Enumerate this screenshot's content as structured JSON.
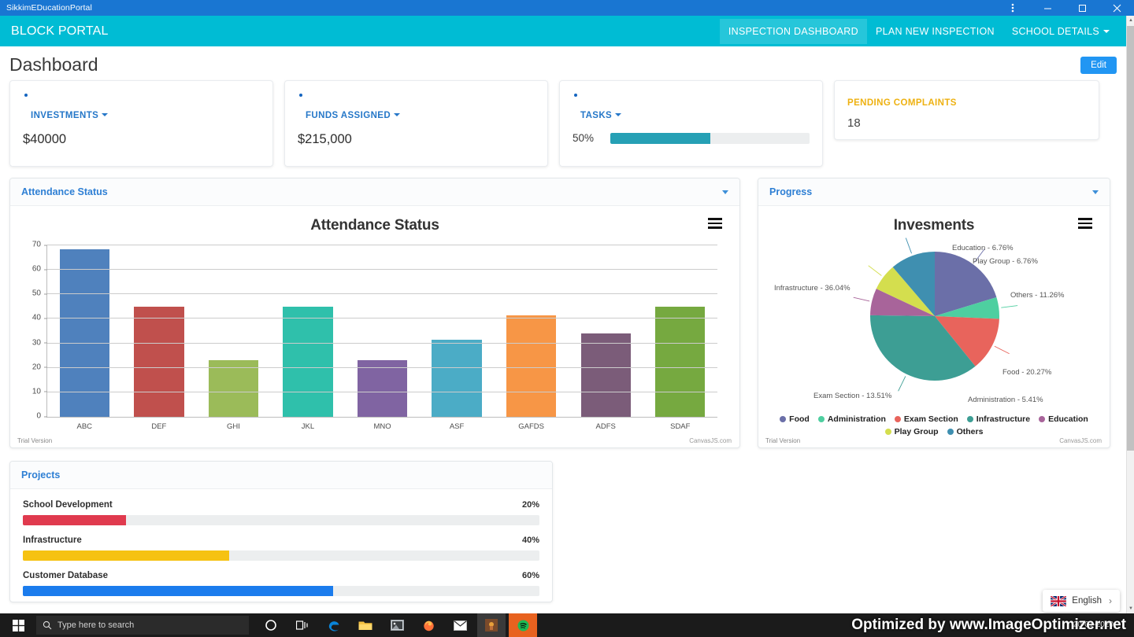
{
  "window": {
    "app_title": "SikkimEDucationPortal",
    "controls": [
      "more-options",
      "minimize",
      "maximize",
      "close"
    ]
  },
  "navbar": {
    "brand": "BLOCK PORTAL",
    "links": [
      {
        "label": "INSPECTION DASHBOARD",
        "active": true,
        "caret": false
      },
      {
        "label": "PLAN NEW INSPECTION",
        "active": false,
        "caret": false
      },
      {
        "label": "SCHOOL DETAILS",
        "active": false,
        "caret": true
      }
    ]
  },
  "page": {
    "title": "Dashboard",
    "edit_label": "Edit"
  },
  "kpis": [
    {
      "label": "INVESTMENTS",
      "value": "$40000",
      "caret": true,
      "dot": true,
      "type": "value"
    },
    {
      "label": "FUNDS ASSIGNED",
      "value": "$215,000",
      "caret": true,
      "dot": true,
      "type": "value"
    },
    {
      "label": "TASKS",
      "value": "50%",
      "percent": 50,
      "caret": true,
      "dot": true,
      "type": "progress"
    },
    {
      "label": "PENDING COMPLAINTS",
      "value": "18",
      "caret": false,
      "dot": false,
      "type": "value"
    }
  ],
  "panels": {
    "attendance": {
      "title": "Attendance Status"
    },
    "progress": {
      "title": "Progress"
    },
    "projects": {
      "title": "Projects"
    }
  },
  "chart_data": [
    {
      "type": "bar",
      "title": "Attendance Status",
      "categories": [
        "ABC",
        "DEF",
        "GHI",
        "JKL",
        "MNO",
        "ASF",
        "GAFDS",
        "ADFS",
        "SDAF"
      ],
      "values": [
        68.5,
        45,
        23,
        45,
        23,
        31.5,
        41.5,
        34,
        45
      ],
      "colors": [
        "#4f81bd",
        "#c0504d",
        "#9bbb59",
        "#2fc0ab",
        "#8064a2",
        "#4bacc6",
        "#f79646",
        "#7b5c79",
        "#76a940"
      ],
      "xlabel": "",
      "ylabel": "",
      "ylim": [
        0,
        70
      ],
      "yticks": [
        0,
        10,
        20,
        30,
        40,
        50,
        60,
        70
      ],
      "grid": true,
      "watermark": "Trial Version",
      "credit": "CanvasJS.com"
    },
    {
      "type": "pie",
      "title": "Invesments",
      "labels": [
        "Food",
        "Administration",
        "Exam Section",
        "Infrastructure",
        "Education",
        "Play Group",
        "Others"
      ],
      "values": [
        20.27,
        5.41,
        13.51,
        36.04,
        6.76,
        6.76,
        11.26
      ],
      "colors": [
        "#6b6fa8",
        "#4ecfa0",
        "#e8645c",
        "#3d9e94",
        "#a8649a",
        "#d4de4e",
        "#3f8fb0"
      ],
      "point_labels": [
        "Education - 6.76%",
        "Play Group - 6.76%",
        "Others - 11.26%",
        "Food - 20.27%",
        "Administration - 5.41%",
        "Exam Section - 13.51%",
        "Infrastructure - 36.04%"
      ],
      "legend_position": "bottom",
      "watermark": "Trial Version",
      "credit": "CanvasJS.com"
    }
  ],
  "projects": [
    {
      "name": "School Development",
      "percent_label": "20%",
      "percent": 20,
      "color": "#e03a4e"
    },
    {
      "name": "Infrastructure",
      "percent_label": "40%",
      "percent": 40,
      "color": "#f6c211"
    },
    {
      "name": "Customer Database",
      "percent_label": "60%",
      "percent": 60,
      "color": "#1b7ced"
    }
  ],
  "language_widget": {
    "label": "English",
    "arrow": "›"
  },
  "taskbar": {
    "search_placeholder": "Type here to search",
    "icons": [
      "cortana-icon",
      "task-view-icon",
      "edge-icon",
      "file-explorer-icon",
      "photos-icon",
      "firefox-icon",
      "mail-icon",
      "app-icon",
      "spotify-icon"
    ],
    "clock_time": "",
    "clock_date": "20-01-2020"
  },
  "watermark": "Optimized by www.ImageOptimizer.net"
}
